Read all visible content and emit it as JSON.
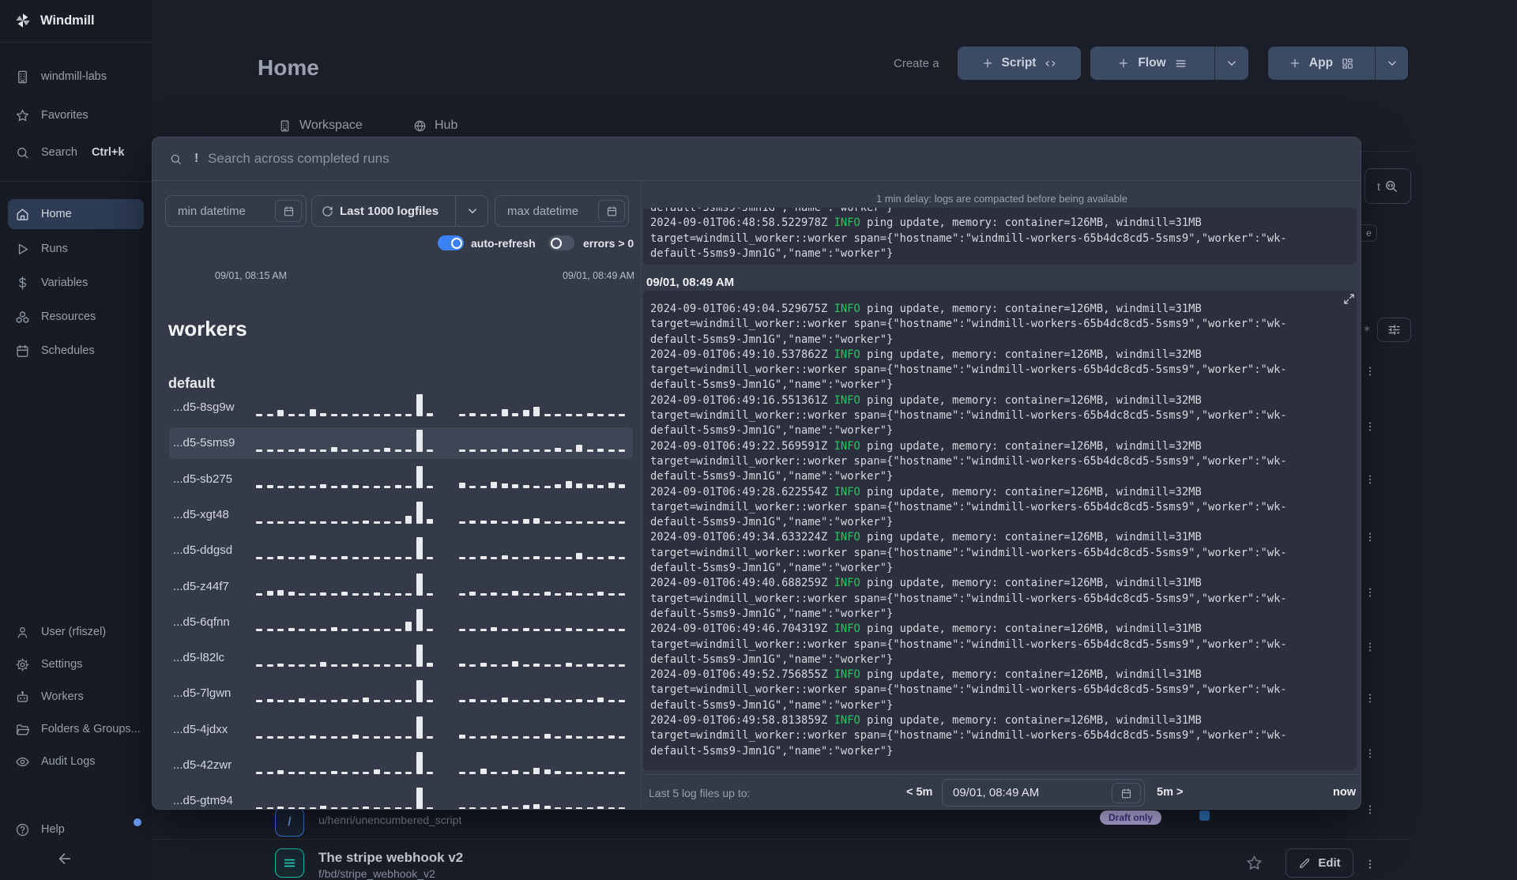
{
  "colors": {
    "accent_blue": "#3B82F6",
    "info_green": "#22C55E",
    "badge_purple_bg": "#C8BEF5",
    "badge_purple_text": "#4B3A94",
    "teal_accent": "#2DD4BF",
    "bar_white": "#E9EBEF"
  },
  "sidebar": {
    "brand": {
      "label": "Windmill",
      "icon": "windmill-logo"
    },
    "top_items": [
      {
        "label": "windmill-labs",
        "icon": "building-icon"
      },
      {
        "label": "Favorites",
        "icon": "star-icon"
      },
      {
        "label": "Search",
        "icon": "search-icon",
        "shortcut": "Ctrl+k"
      }
    ],
    "nav_items": [
      {
        "label": "Home",
        "icon": "home-icon",
        "active": true
      },
      {
        "label": "Runs",
        "icon": "play-icon"
      },
      {
        "label": "Variables",
        "icon": "dollar-icon"
      },
      {
        "label": "Resources",
        "icon": "resources-icon"
      },
      {
        "label": "Schedules",
        "icon": "calendar-icon"
      }
    ],
    "bottom_items": [
      {
        "label": "User (rfiszel)",
        "icon": "user-icon"
      },
      {
        "label": "Settings",
        "icon": "gear-icon"
      },
      {
        "label": "Workers",
        "icon": "robot-icon"
      },
      {
        "label": "Folders & Groups...",
        "icon": "folder-icon"
      },
      {
        "label": "Audit Logs",
        "icon": "eye-icon"
      }
    ],
    "help": {
      "label": "Help",
      "icon": "help-icon"
    },
    "collapse_icon": "arrow-left-icon"
  },
  "header": {
    "title": "Home",
    "create_label": "Create a",
    "buttons": [
      {
        "label": "Script",
        "plus_icon": "plus-icon",
        "type_icon": "code-icon",
        "has_dropdown": false
      },
      {
        "label": "Flow",
        "plus_icon": "plus-icon",
        "type_icon": "list-icon",
        "has_dropdown": true
      },
      {
        "label": "App",
        "plus_icon": "plus-icon",
        "type_icon": "grid-icon",
        "has_dropdown": true
      }
    ]
  },
  "tabs": [
    {
      "label": "Workspace",
      "icon": "building-icon"
    },
    {
      "label": "Hub",
      "icon": "globe-icon"
    }
  ],
  "modal": {
    "search": {
      "prefix": "!",
      "placeholder": "Search across completed runs",
      "icon": "search-icon"
    },
    "filters": {
      "min": {
        "label": "min datetime",
        "icon": "calendar-icon"
      },
      "logfiles": {
        "label": "Last 1000 logfiles",
        "icon": "refresh-icon",
        "chevron": "chevron-down-icon"
      },
      "max": {
        "label": "max datetime",
        "icon": "calendar-icon"
      },
      "auto_refresh": {
        "label": "auto-refresh",
        "on": true
      },
      "errors": {
        "label": "errors > 0",
        "on": false
      }
    },
    "range": {
      "start": "09/01, 08:15 AM",
      "end": "09/01, 08:49 AM"
    },
    "workers_heading": "workers",
    "group_heading": "default",
    "selected_worker": "...d5-5sms9",
    "chart_data": {
      "type": "bar",
      "title": "per-worker log activity sparklines (bar heights in px, 0 = gap)",
      "workers": [
        {
          "label": "...d5-8sg9w",
          "bars": [
            3,
            3,
            8,
            3,
            3,
            9,
            4,
            3,
            3,
            3,
            3,
            3,
            3,
            3,
            3,
            28,
            4,
            0,
            0,
            3,
            4,
            3,
            3,
            9,
            4,
            8,
            12,
            3,
            3,
            3,
            3,
            4,
            3,
            3,
            3
          ]
        },
        {
          "label": "...d5-5sms9",
          "bars": [
            3,
            3,
            3,
            3,
            4,
            3,
            3,
            6,
            3,
            3,
            3,
            3,
            5,
            3,
            3,
            28,
            3,
            0,
            0,
            3,
            3,
            3,
            3,
            4,
            3,
            3,
            3,
            3,
            5,
            3,
            9,
            3,
            4,
            3,
            3
          ]
        },
        {
          "label": "...d5-sb275",
          "bars": [
            4,
            4,
            3,
            3,
            3,
            3,
            5,
            3,
            4,
            4,
            3,
            3,
            3,
            4,
            3,
            28,
            3,
            0,
            0,
            7,
            3,
            3,
            8,
            6,
            5,
            4,
            3,
            3,
            5,
            9,
            6,
            5,
            4,
            7,
            5
          ]
        },
        {
          "label": "...d5-xgt48",
          "bars": [
            3,
            3,
            3,
            3,
            3,
            3,
            3,
            3,
            3,
            3,
            4,
            3,
            3,
            3,
            10,
            28,
            6,
            0,
            0,
            3,
            4,
            4,
            4,
            3,
            4,
            6,
            7,
            3,
            3,
            3,
            3,
            3,
            3,
            3,
            3
          ]
        },
        {
          "label": "...d5-ddgsd",
          "bars": [
            3,
            3,
            4,
            3,
            3,
            5,
            3,
            3,
            4,
            3,
            3,
            3,
            3,
            3,
            3,
            28,
            3,
            0,
            0,
            3,
            3,
            4,
            3,
            5,
            3,
            3,
            4,
            3,
            3,
            3,
            8,
            3,
            3,
            4,
            3
          ]
        },
        {
          "label": "...d5-z44f7",
          "bars": [
            3,
            6,
            7,
            5,
            3,
            3,
            4,
            3,
            5,
            3,
            3,
            4,
            3,
            3,
            3,
            28,
            3,
            0,
            0,
            3,
            5,
            3,
            4,
            3,
            6,
            3,
            3,
            5,
            3,
            4,
            3,
            3,
            5,
            3,
            3
          ]
        },
        {
          "label": "...d5-6qfnn",
          "bars": [
            3,
            3,
            3,
            4,
            3,
            3,
            3,
            5,
            3,
            3,
            3,
            3,
            3,
            3,
            12,
            28,
            3,
            0,
            0,
            3,
            3,
            3,
            5,
            3,
            3,
            4,
            3,
            3,
            3,
            4,
            3,
            3,
            3,
            3,
            3
          ]
        },
        {
          "label": "...d5-l82lc",
          "bars": [
            3,
            3,
            4,
            3,
            3,
            3,
            6,
            3,
            3,
            4,
            3,
            3,
            3,
            3,
            3,
            28,
            5,
            0,
            0,
            4,
            3,
            5,
            3,
            3,
            7,
            3,
            4,
            3,
            3,
            5,
            3,
            4,
            3,
            3,
            3
          ]
        },
        {
          "label": "...d5-7lgwn",
          "bars": [
            3,
            4,
            3,
            3,
            5,
            3,
            3,
            3,
            4,
            3,
            6,
            3,
            3,
            3,
            3,
            28,
            3,
            0,
            0,
            3,
            4,
            3,
            3,
            6,
            3,
            3,
            3,
            5,
            3,
            3,
            4,
            3,
            6,
            3,
            3
          ]
        },
        {
          "label": "...d5-4jdxx",
          "bars": [
            3,
            3,
            3,
            3,
            3,
            4,
            3,
            3,
            3,
            5,
            3,
            3,
            3,
            3,
            3,
            28,
            3,
            0,
            0,
            5,
            3,
            3,
            4,
            3,
            3,
            3,
            3,
            6,
            3,
            4,
            3,
            3,
            3,
            4,
            3
          ]
        },
        {
          "label": "...d5-42zwr",
          "bars": [
            3,
            3,
            5,
            3,
            3,
            3,
            3,
            4,
            3,
            3,
            3,
            6,
            3,
            3,
            3,
            28,
            3,
            0,
            0,
            3,
            3,
            7,
            3,
            3,
            5,
            3,
            8,
            6,
            4,
            3,
            3,
            3,
            3,
            3,
            3
          ]
        },
        {
          "label": "...d5-gtm94",
          "bars": [
            3,
            3,
            4,
            3,
            3,
            3,
            5,
            3,
            3,
            3,
            4,
            3,
            3,
            3,
            3,
            28,
            3,
            0,
            0,
            3,
            3,
            3,
            3,
            5,
            3,
            6,
            7,
            5,
            3,
            3,
            3,
            3,
            4,
            3,
            3
          ]
        }
      ]
    },
    "logs": {
      "delay_note": "1 min delay: logs are compacted before being available",
      "section_label": "09/01, 08:49 AM",
      "level": "INFO",
      "msg_prefix": "ping update, memory: container=",
      "msg_mid": ", windmill=",
      "span_line": "target=windmill_worker::worker span={\"hostname\":\"windmill-workers-65b4dc8cd5-5sms9\",\"worker\":\"wk-",
      "tail_line": "default-5sms9-Jmn1G\",\"name\":\"worker\"}",
      "scrollback": {
        "partial_line": "default-5sms9-Jmn1G\",\"name\":\"worker\"}",
        "entry": {
          "ts": "2024-09-01T06:48:58.522978Z",
          "container": "126MB",
          "windmill": "31MB"
        }
      },
      "entries": [
        {
          "ts": "2024-09-01T06:49:04.529675Z",
          "container": "126MB",
          "windmill": "31MB"
        },
        {
          "ts": "2024-09-01T06:49:10.537862Z",
          "container": "126MB",
          "windmill": "32MB"
        },
        {
          "ts": "2024-09-01T06:49:16.551361Z",
          "container": "126MB",
          "windmill": "32MB"
        },
        {
          "ts": "2024-09-01T06:49:22.569591Z",
          "container": "126MB",
          "windmill": "32MB"
        },
        {
          "ts": "2024-09-01T06:49:28.622554Z",
          "container": "126MB",
          "windmill": "32MB"
        },
        {
          "ts": "2024-09-01T06:49:34.633224Z",
          "container": "126MB",
          "windmill": "31MB"
        },
        {
          "ts": "2024-09-01T06:49:40.688259Z",
          "container": "126MB",
          "windmill": "31MB"
        },
        {
          "ts": "2024-09-01T06:49:46.704319Z",
          "container": "126MB",
          "windmill": "31MB"
        },
        {
          "ts": "2024-09-01T06:49:52.756855Z",
          "container": "126MB",
          "windmill": "31MB"
        },
        {
          "ts": "2024-09-01T06:49:58.813859Z",
          "container": "126MB",
          "windmill": "31MB"
        }
      ],
      "expand_icon": "expand-icon"
    },
    "footer": {
      "label": "Last 5 log files up to:",
      "back": "< 5m",
      "datetime": "09/01, 08:49 AM",
      "datetime_icon": "calendar-icon",
      "forward": "5m >",
      "now": "now"
    }
  },
  "background": {
    "rows": [
      {
        "path": "u/henri/unencumbered_script",
        "icon": "script-badge-icon",
        "accent": "#3B82F6"
      },
      {
        "title": "The stripe webhook v2",
        "path": "f/bd/stripe_webhook_v2",
        "icon": "flow-badge-icon",
        "accent": "#2DD4BF"
      }
    ],
    "draft_badge": "Draft only",
    "edit_button": {
      "label": "Edit",
      "icon": "pencil-icon"
    },
    "rail": {
      "search_button_icon": "search-code-icon",
      "filter_button_icon": "sliders-icon",
      "kebab_icon": "kebab-icon",
      "partial_text_left": "t",
      "partial_text_fragment": "e",
      "asterisk_icon": "asterisk-icon"
    }
  }
}
